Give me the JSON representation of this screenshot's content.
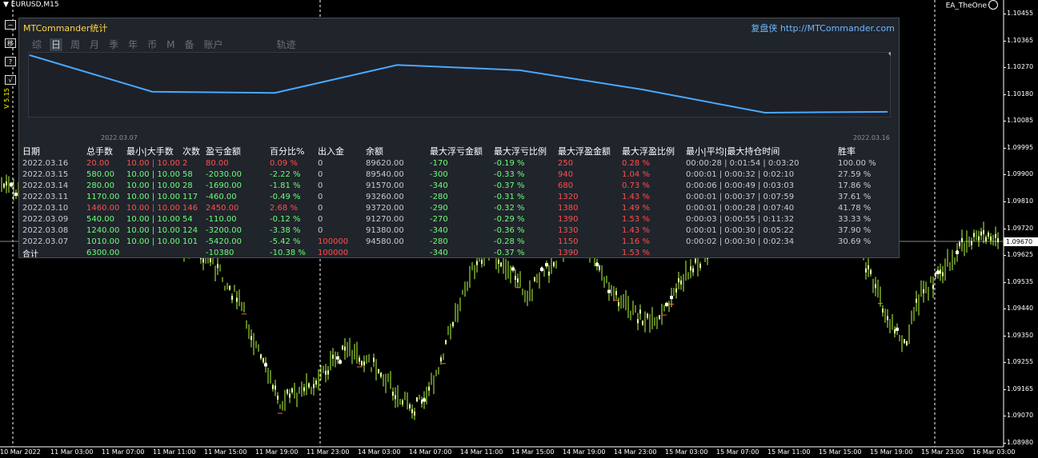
{
  "chart_window": {
    "symbol": "EURUSD,M15",
    "ea_label": "EA_TheOne",
    "vertical_label": "V 5.15",
    "current_price": "1.09670",
    "price_axis": [
      "1.10455",
      "1.10365",
      "1.10270",
      "1.10180",
      "1.10085",
      "1.09995",
      "1.09900",
      "1.09810",
      "1.09720",
      "1.09625",
      "1.09535",
      "1.09440",
      "1.09350",
      "1.09255",
      "1.09165",
      "1.09070",
      "1.08980"
    ],
    "time_axis": [
      "10 Mar 2022",
      "11 Mar 03:00",
      "11 Mar 07:00",
      "11 Mar 11:00",
      "11 Mar 15:00",
      "11 Mar 19:00",
      "11 Mar 23:00",
      "14 Mar 03:00",
      "14 Mar 07:00",
      "14 Mar 11:00",
      "14 Mar 15:00",
      "14 Mar 19:00",
      "14 Mar 23:00",
      "15 Mar 03:00",
      "15 Mar 07:00",
      "15 Mar 11:00",
      "15 Mar 15:00",
      "15 Mar 19:00",
      "15 Mar 23:00",
      "16 Mar 03:00"
    ],
    "side_buttons": [
      "−",
      "移",
      "?",
      "√"
    ],
    "colors": {
      "candle": "#b8ff3c",
      "grid": "#ffffff",
      "panel_bg": "#20242b",
      "equity_line": "#4aa8ff"
    }
  },
  "panel": {
    "title": "MTCommander统计",
    "site": "复盘侠 http://MTCommander.com",
    "tabs": [
      {
        "label": "综",
        "active": false
      },
      {
        "label": "日",
        "active": true
      },
      {
        "label": "周",
        "active": false
      },
      {
        "label": "月",
        "active": false
      },
      {
        "label": "季",
        "active": false
      },
      {
        "label": "年",
        "active": false
      },
      {
        "label": "币",
        "active": false
      },
      {
        "label": "M",
        "active": false
      },
      {
        "label": "备",
        "active": false
      },
      {
        "label": "账户",
        "active": false
      },
      {
        "label": "轨迹",
        "active": false
      }
    ],
    "equity_start_label": "2022.03.07",
    "equity_end_label": "2022.03.16",
    "equity_values": [
      94580,
      91380,
      91270,
      93720,
      93260,
      91570,
      89540,
      89620
    ],
    "columns": [
      "日期",
      "总手数",
      "最小|大手数",
      "次数",
      "盈亏金额",
      "百分比%",
      "出入金",
      "余额",
      "最大浮亏金额",
      "最大浮亏比例",
      "最大浮盈金额",
      "最大浮盈比例",
      "最小|平均|最大持仓时间",
      "胜率"
    ],
    "rows": [
      [
        "2022.03.16",
        "20.00",
        "10.00 | 10.00",
        "2",
        "80.00",
        "0.09 %",
        "0",
        "89620.00",
        "-170",
        "-0.19 %",
        "250",
        "0.28 %",
        "00:00:28 | 0:01:54 | 0:03:20",
        "100.00 %"
      ],
      [
        "2022.03.15",
        "580.00",
        "10.00 | 10.00",
        "58",
        "-2030.00",
        "-2.22 %",
        "0",
        "89540.00",
        "-300",
        "-0.33 %",
        "940",
        "1.04 %",
        "0:00:01 | 0:00:32 | 0:02:10",
        "27.59 %"
      ],
      [
        "2022.03.14",
        "280.00",
        "10.00 | 10.00",
        "28",
        "-1690.00",
        "-1.81 %",
        "0",
        "91570.00",
        "-340",
        "-0.37 %",
        "680",
        "0.73 %",
        "0:00:06 | 0:00:49 | 0:03:03",
        "17.86 %"
      ],
      [
        "2022.03.11",
        "1170.00",
        "10.00 | 10.00",
        "117",
        "-460.00",
        "-0.49 %",
        "0",
        "93260.00",
        "-280",
        "-0.31 %",
        "1320",
        "1.43 %",
        "0:00:01 | 0:00:37 | 0:07:59",
        "37.61 %"
      ],
      [
        "2022.03.10",
        "1460.00",
        "10.00 | 10.00",
        "146",
        "2450.00",
        "2.68 %",
        "0",
        "93720.00",
        "-290",
        "-0.32 %",
        "1380",
        "1.49 %",
        "0:00:01 | 0:00:28 | 0:07:40",
        "41.78 %"
      ],
      [
        "2022.03.09",
        "540.00",
        "10.00 | 10.00",
        "54",
        "-110.00",
        "-0.12 %",
        "0",
        "91270.00",
        "-270",
        "-0.29 %",
        "1390",
        "1.53 %",
        "0:00:03 | 0:00:55 | 0:11:32",
        "33.33 %"
      ],
      [
        "2022.03.08",
        "1240.00",
        "10.00 | 10.00",
        "124",
        "-3200.00",
        "-3.38 %",
        "0",
        "91380.00",
        "-340",
        "-0.36 %",
        "1330",
        "1.43 %",
        "0:00:01 | 0:00:30 | 0:05:22",
        "37.90 %"
      ],
      [
        "2022.03.07",
        "1010.00",
        "10.00 | 10.00",
        "101",
        "-5420.00",
        "-5.42 %",
        "100000",
        "94580.00",
        "-280",
        "-0.28 %",
        "1150",
        "1.16 %",
        "0:00:02 | 0:00:30 | 0:02:34",
        "30.69 %"
      ]
    ],
    "total": [
      "合计",
      "6300.00",
      "",
      "",
      "-10380",
      "-10.38 %",
      "100000",
      "",
      "-340",
      "-0.37 %",
      "1390",
      "1.53 %",
      "",
      ""
    ]
  }
}
